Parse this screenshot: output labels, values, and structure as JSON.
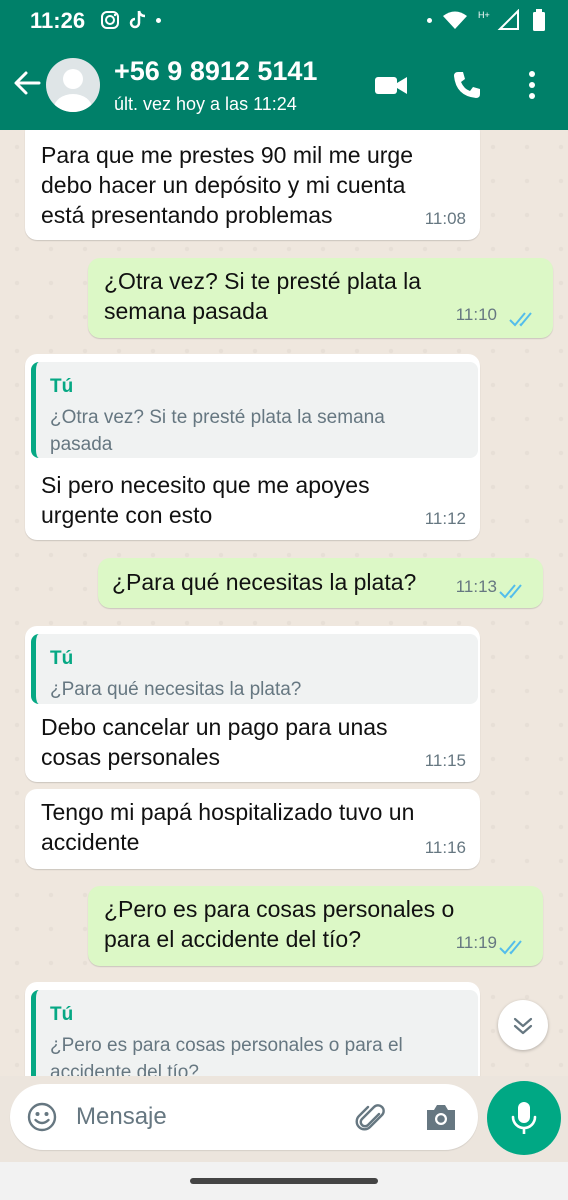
{
  "status_bar": {
    "time": "11:26"
  },
  "header": {
    "contact_name": "+56 9 8912 5141",
    "last_seen": "últ. vez hoy a las 11:24"
  },
  "messages": [
    {
      "direction": "in",
      "text": "Para que me prestes 90 mil me urge\ndebo hacer un depósito y mi cuenta\nestá presentando problemas",
      "time": "11:08"
    },
    {
      "direction": "out",
      "text": "¿Otra vez? Si te presté plata la\nsemana pasada",
      "time": "11:10",
      "status": "read"
    },
    {
      "direction": "in",
      "quote_author": "Tú",
      "quote_text": "¿Otra vez? Si te presté plata la semana\npasada",
      "text": "Si pero necesito que me apoyes\nurgente con esto",
      "time": "11:12"
    },
    {
      "direction": "out",
      "text": "¿Para qué necesitas la plata?",
      "time": "11:13",
      "status": "read"
    },
    {
      "direction": "in",
      "quote_author": "Tú",
      "quote_text": "¿Para qué necesitas la plata?",
      "text": "Debo cancelar un pago para unas\ncosas personales",
      "time": "11:15"
    },
    {
      "direction": "in",
      "text": "Tengo mi papá hospitalizado tuvo un\naccidente",
      "time": "11:16"
    },
    {
      "direction": "out",
      "text": "¿Pero es para cosas personales o\npara el accidente del tío?",
      "time": "11:19",
      "status": "read"
    },
    {
      "direction": "in",
      "quote_author": "Tú",
      "quote_text": "¿Pero es para cosas personales o para el\naccidente del tío?"
    }
  ],
  "composer": {
    "placeholder": "Mensaje"
  },
  "colors": {
    "brand": "#008069",
    "outgoing_bubble": "#dcf8c6",
    "read_ticks": "#53bdeb",
    "quote_accent": "#06a884",
    "mic_button": "#00a884"
  },
  "icons": [
    "instagram-icon",
    "tiktok-icon",
    "back-arrow-icon",
    "default-avatar-icon",
    "video-call-icon",
    "phone-icon",
    "more-options-icon",
    "double-check-icon",
    "chevrons-down-icon",
    "emoji-icon",
    "attach-icon",
    "camera-icon",
    "mic-icon"
  ]
}
